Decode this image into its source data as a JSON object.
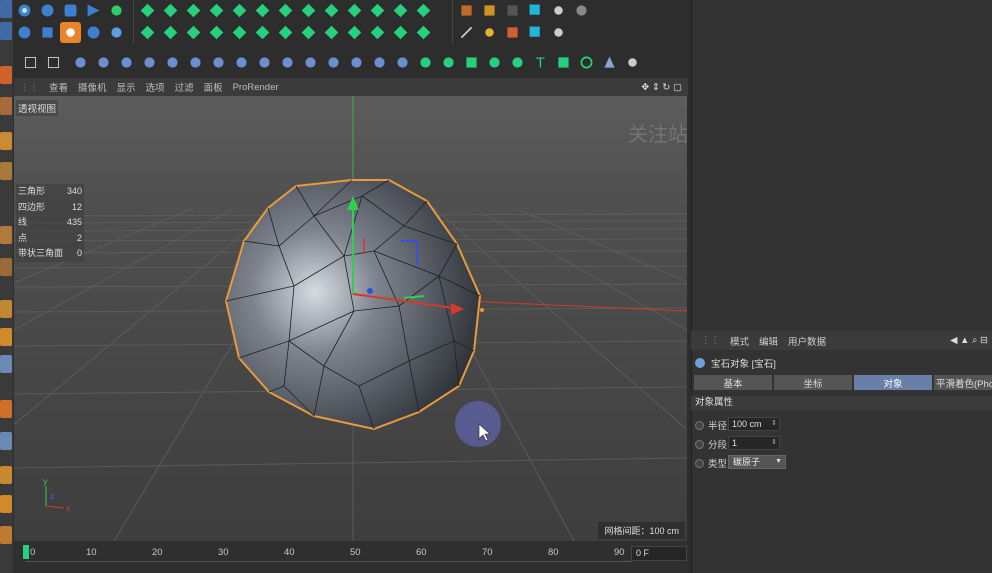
{
  "viewport_menu": [
    "查看",
    "摄像机",
    "显示",
    "选项",
    "过滤",
    "面板",
    "ProRender"
  ],
  "viewport_label": "透视视图",
  "watermark": "关注站酷/B站：尚同墨方",
  "stats": [
    {
      "label": "三角形",
      "value": "340"
    },
    {
      "label": "四边形",
      "value": "12"
    },
    {
      "label": "线",
      "value": "435"
    },
    {
      "label": "点",
      "value": "2"
    },
    {
      "label": "带状三角面",
      "value": "0"
    }
  ],
  "grid_spacing": "网格间距：100 cm",
  "timeline": {
    "ticks": [
      "0",
      "10",
      "20",
      "30",
      "40",
      "50",
      "60",
      "70",
      "80",
      "90"
    ],
    "current_frame": "0 F"
  },
  "attributes": {
    "menu": [
      "模式",
      "编辑",
      "用户数据"
    ],
    "object_title": "宝石对象 [宝石]",
    "tabs": [
      "基本",
      "坐标",
      "对象",
      "平滑着色(Pho"
    ],
    "section_title": "对象属性",
    "radius_label": "半径",
    "radius_value": "100 cm",
    "segments_label": "分段",
    "segments_value": "1",
    "type_label": "类型",
    "type_value": "碳原子"
  },
  "colors": {
    "accent_green": "#26d07c",
    "selection_orange": "#e89a3c",
    "active_tab": "#6a7fa8"
  }
}
